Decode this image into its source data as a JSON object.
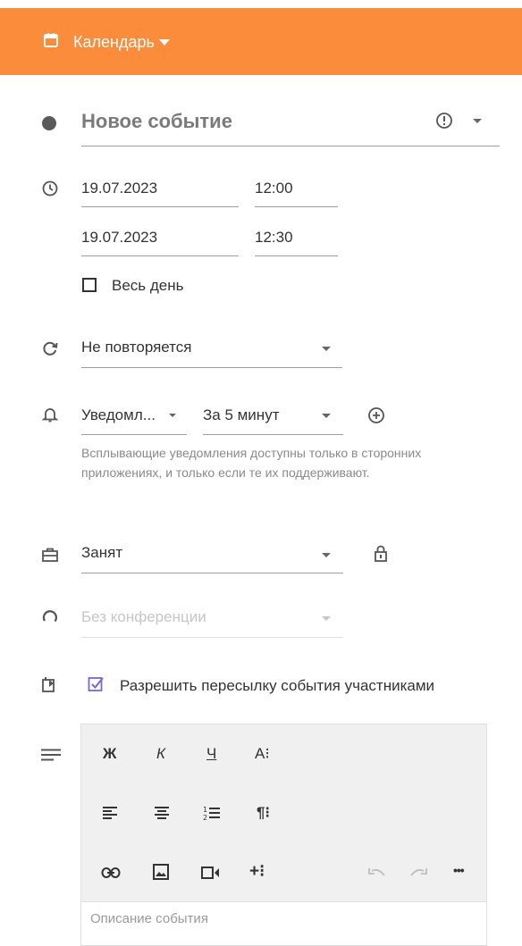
{
  "header": {
    "title": "Календарь",
    "bg_color": "#fb8c3c"
  },
  "event": {
    "title_placeholder": "Новое событие",
    "start_date": "19.07.2023",
    "start_time": "12:00",
    "end_date": "19.07.2023",
    "end_time": "12:30",
    "all_day_label": "Весь день",
    "all_day_checked": false,
    "repeat": "Не повторяется",
    "notify_type": "Уведомл...",
    "notify_time": "За 5 минут",
    "notify_hint": "Всплывающие уведомления доступны только в сторонних приложениях, и только если те их поддерживают.",
    "busy": "Занят",
    "conference": "Без конференции",
    "forward_label": "Разрешить пересылку события участниками",
    "forward_checked": true,
    "accent_color": "#7b68c8"
  },
  "toolbar": {
    "bold": "Ж",
    "italic": "К",
    "underline": "Ч",
    "font": "A⁝",
    "paragraph": "¶⁝",
    "insert_more": "+⁝",
    "more": "•••"
  },
  "description_placeholder": "Описание события"
}
